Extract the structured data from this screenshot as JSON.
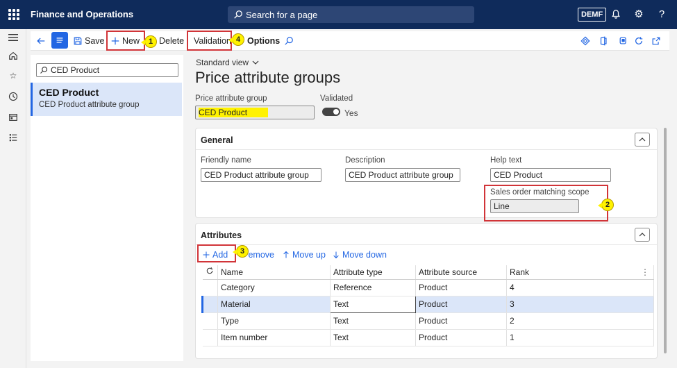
{
  "topbar": {
    "app_title": "Finance and Operations",
    "search_placeholder": "Search for a page",
    "company": "DEMF"
  },
  "actionpane": {
    "save": "Save",
    "new": "New",
    "delete": "Delete",
    "validation": "Validation",
    "options": "Options"
  },
  "callouts": {
    "c1": "1",
    "c2": "2",
    "c3": "3",
    "c4": "4"
  },
  "list": {
    "filter_value": "CED Product",
    "item_title": "CED Product",
    "item_subtitle": "CED Product attribute group"
  },
  "header": {
    "view": "Standard view",
    "title": "Price attribute groups",
    "group_label": "Price attribute group",
    "group_value": "CED Product",
    "validated_label": "Validated",
    "validated_value": "Yes"
  },
  "general": {
    "title": "General",
    "friendly_name_label": "Friendly name",
    "friendly_name_value": "CED Product attribute group",
    "description_label": "Description",
    "description_value": "CED Product attribute group",
    "help_text_label": "Help text",
    "help_text_value": "CED Product",
    "scope_label": "Sales order matching scope",
    "scope_value": "Line"
  },
  "attributes": {
    "title": "Attributes",
    "add": "Add",
    "remove": "Remove",
    "move_up": "Move up",
    "move_down": "Move down",
    "columns": [
      "Name",
      "Attribute type",
      "Attribute source",
      "Rank"
    ],
    "rows": [
      {
        "name": "Category",
        "type": "Reference",
        "source": "Product",
        "rank": "4"
      },
      {
        "name": "Material",
        "type": "Text",
        "source": "Product",
        "rank": "3"
      },
      {
        "name": "Type",
        "type": "Text",
        "source": "Product",
        "rank": "2"
      },
      {
        "name": "Item number",
        "type": "Text",
        "source": "Product",
        "rank": "1"
      }
    ]
  },
  "colors": {
    "topbar": "#0f2b5b",
    "accent": "#2266e3",
    "highlight": "#fff200",
    "callout_border": "#d13438"
  }
}
